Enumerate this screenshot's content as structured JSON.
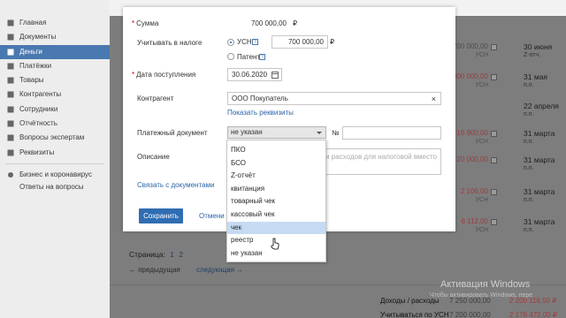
{
  "sidebar": {
    "items": [
      {
        "label": "Главная",
        "icon": "home-icon"
      },
      {
        "label": "Документы",
        "icon": "documents-icon"
      },
      {
        "label": "Деньги",
        "icon": "money-icon",
        "active": true
      },
      {
        "label": "Платёжки",
        "icon": "payments-icon"
      },
      {
        "label": "Товары",
        "icon": "goods-icon"
      },
      {
        "label": "Контрагенты",
        "icon": "contractors-icon"
      },
      {
        "label": "Сотрудники",
        "icon": "employees-icon"
      },
      {
        "label": "Отчётность",
        "icon": "reports-icon"
      },
      {
        "label": "Вопросы экспертам",
        "icon": "questions-icon"
      },
      {
        "label": "Реквизиты",
        "icon": "requisites-icon"
      }
    ],
    "extra": {
      "label": "Бизнес и коронавирус",
      "sub": "Ответы на вопросы",
      "icon": "virus-info-icon"
    }
  },
  "background_list": {
    "rows": [
      {
        "amount": "700 000,00",
        "amount_sub": "УСН",
        "date": "30 июня",
        "date_sub": "Z-отч.",
        "kind": "income"
      },
      {
        "amount": "2 000 000,00",
        "amount_sub": "УСН",
        "date": "31 мая",
        "date_sub": "п.п.",
        "kind": "expense"
      },
      {
        "amount": "",
        "amount_sub": "",
        "date": "22 апреля",
        "date_sub": "п.п.",
        "kind": "income"
      },
      {
        "amount": "16 900,00",
        "amount_sub": "УСН",
        "date": "31 марта",
        "date_sub": "п.п.",
        "kind": "expense"
      },
      {
        "amount": "20 000,00",
        "amount_sub": "",
        "date": "31 марта",
        "date_sub": "п.п.",
        "kind": "expense"
      },
      {
        "amount": "2 106,00",
        "amount_sub": "УСН",
        "date": "31 марта",
        "date_sub": "п.п.",
        "kind": "expense"
      },
      {
        "amount": "6 112,00",
        "amount_sub": "УСН",
        "date": "31 марта",
        "date_sub": "п.п.",
        "kind": "expense"
      }
    ],
    "pager_label": "Страница:",
    "pages": [
      "1",
      "2"
    ],
    "prev": "← предыдущая",
    "next": "следующая →",
    "totals": [
      {
        "label": "Доходы / расходы",
        "income": "7 250 000,00",
        "expense": "2 200 116,50 ₽"
      },
      {
        "label": "Учитываться по УСН",
        "income": "7 200 000,00",
        "expense": "2 176 472,00 ₽"
      }
    ]
  },
  "modal": {
    "amount_label": "Сумма",
    "amount_value": "700 000,00",
    "currency": "₽",
    "tax_label": "Учитывать в налоге",
    "usn_label": "УСН",
    "usn_value": "700 000,00",
    "patent_label": "Патент",
    "date_label": "Дата поступления",
    "date_value": "30.06.2020",
    "contractor_label": "Контрагент",
    "contractor_value": "ООО Покупатель",
    "show_requisites": "Показать реквизиты",
    "pay_doc_label": "Платежный документ",
    "pay_doc_selected": "не указан",
    "number_label": "№",
    "number_value": "",
    "description_label": "Описание",
    "description_placeholder": "а и расходов для налоговой вместо",
    "link_docs": "Связать с документами",
    "save": "Сохранить",
    "cancel": "Отмени"
  },
  "dropdown": {
    "options": [
      "ПКО",
      "БСО",
      "Z-отчёт",
      "квитанция",
      "товарный чек",
      "кассовый чек",
      "чек",
      "реестр",
      "не указан"
    ],
    "highlighted_index": 6
  },
  "watermark": {
    "title": "Активация Windows",
    "sub": "Чтобы активировать Windows, пере"
  },
  "colors": {
    "accent": "#2f6db3",
    "sidebar_active": "#4a78b0",
    "expense_red": "#a43a3a",
    "highlight": "#c6dbf3"
  }
}
